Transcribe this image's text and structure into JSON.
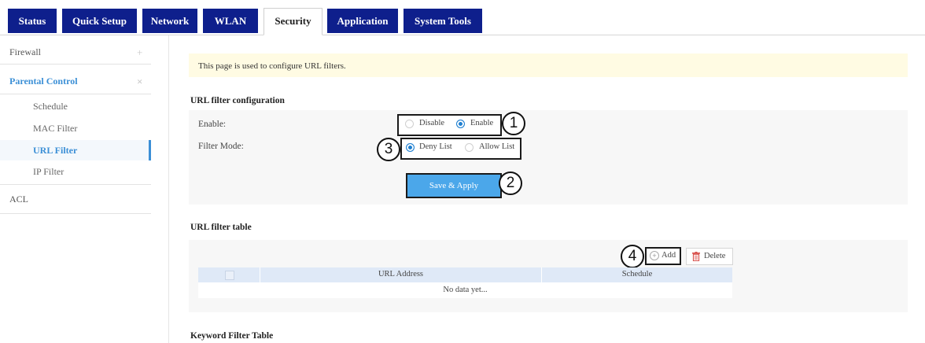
{
  "tabs": [
    {
      "label": "Status"
    },
    {
      "label": "Quick Setup"
    },
    {
      "label": "Network"
    },
    {
      "label": "WLAN"
    },
    {
      "label": "Security"
    },
    {
      "label": "Application"
    },
    {
      "label": "System Tools"
    }
  ],
  "sidebar": {
    "firewall": {
      "label": "Firewall",
      "symbol": "+"
    },
    "parental_control": {
      "label": "Parental Control",
      "symbol": "×"
    },
    "sub_items": [
      {
        "label": "Schedule"
      },
      {
        "label": "MAC Filter"
      },
      {
        "label": "URL Filter"
      },
      {
        "label": "IP Filter"
      }
    ],
    "acl": {
      "label": "ACL"
    }
  },
  "notice": {
    "text": "This page is used to configure URL filters."
  },
  "config": {
    "title": "URL filter configuration",
    "enable_label": "Enable:",
    "enable_options": {
      "disable": "Disable",
      "enable": "Enable",
      "selected": "Enable"
    },
    "mode_label": "Filter Mode:",
    "mode_options": {
      "deny": "Deny List",
      "allow": "Allow List",
      "selected": "Deny List"
    },
    "save_label": "Save & Apply"
  },
  "table": {
    "title": "URL filter table",
    "add_label": "Add",
    "delete_label": "Delete",
    "columns": {
      "url": "URL Address",
      "schedule": "Schedule"
    },
    "empty": "No data yet..."
  },
  "keyword": {
    "title": "Keyword Filter Table"
  },
  "callouts": {
    "c1": "1",
    "c2": "2",
    "c3": "3",
    "c4": "4"
  },
  "colors": {
    "tab_bg": "#0e1f8c",
    "accent": "#1e7fd0",
    "button": "#4ba7ea",
    "notice_bg": "#fffbe3",
    "delete_icon": "#d9534f"
  }
}
